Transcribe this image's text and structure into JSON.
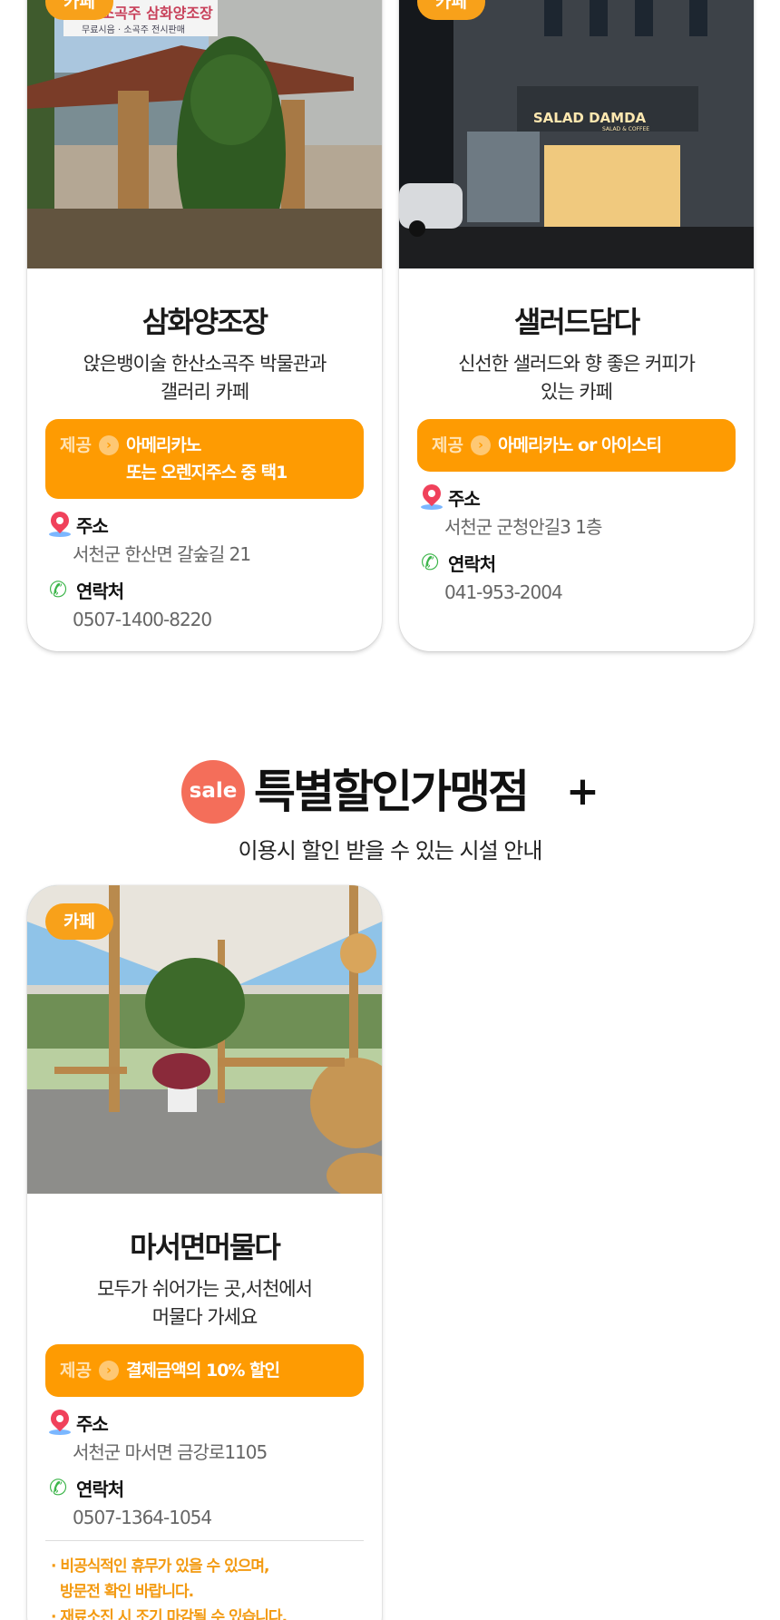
{
  "cards": [
    {
      "tag": "카페",
      "name": "삼화양조장",
      "desc_line1": "앉은뱅이술 한산소곡주 박물관과",
      "desc_line2": "갤러리 카페",
      "offer_label": "제공",
      "offer_line1": "아메리카노",
      "offer_line2": "또는 오렌지주스 중 택1",
      "address_label": "주소",
      "address": "서천군 한산면 갈숲길 21",
      "contact_label": "연락처",
      "phone": "0507-1400-8220",
      "photo_sign1": "한산소곡주 삼화양조장",
      "photo_sign2": "무료시음 · 소곡주 전시판매"
    },
    {
      "tag": "카페",
      "name": "샐러드담다",
      "desc_line1": "신선한 샐러드와 향 좋은 커피가",
      "desc_line2": "있는 카페",
      "offer_label": "제공",
      "offer_line1": "아메리카노 or 아이스티",
      "address_label": "주소",
      "address": "서천군 군청안길3 1층",
      "contact_label": "연락처",
      "phone": "041-953-2004",
      "photo_sign1": "SALAD DAMDA",
      "photo_sign2": "SALAD & COFFEE"
    },
    {
      "tag": "카페",
      "name": "마서면머물다",
      "desc_line1": "모두가 쉬어가는 곳,서천에서",
      "desc_line2": "머물다 가세요",
      "offer_label": "제공",
      "offer_line1": "결제금액의 10% 할인",
      "address_label": "주소",
      "address": "서천군 마서면 금강로1105",
      "contact_label": "연락처",
      "phone": "0507-1364-1054",
      "notice1": "· 비공식적인 휴무가 있을 수 있으며,",
      "notice2": "방문전 확인 바랍니다.",
      "notice3": "· 재료소진 시 조기 마감될 수 있습니다."
    }
  ],
  "section": {
    "badge": "sale",
    "title": "특별할인가맹점",
    "plus": "+",
    "subtitle": "이용시 할인 받을 수 있는 시설 안내"
  },
  "colors": {
    "accent": "#fe9b02",
    "tag": "#f8a11a",
    "sale": "#f46e5a",
    "notice": "#f39a11"
  }
}
